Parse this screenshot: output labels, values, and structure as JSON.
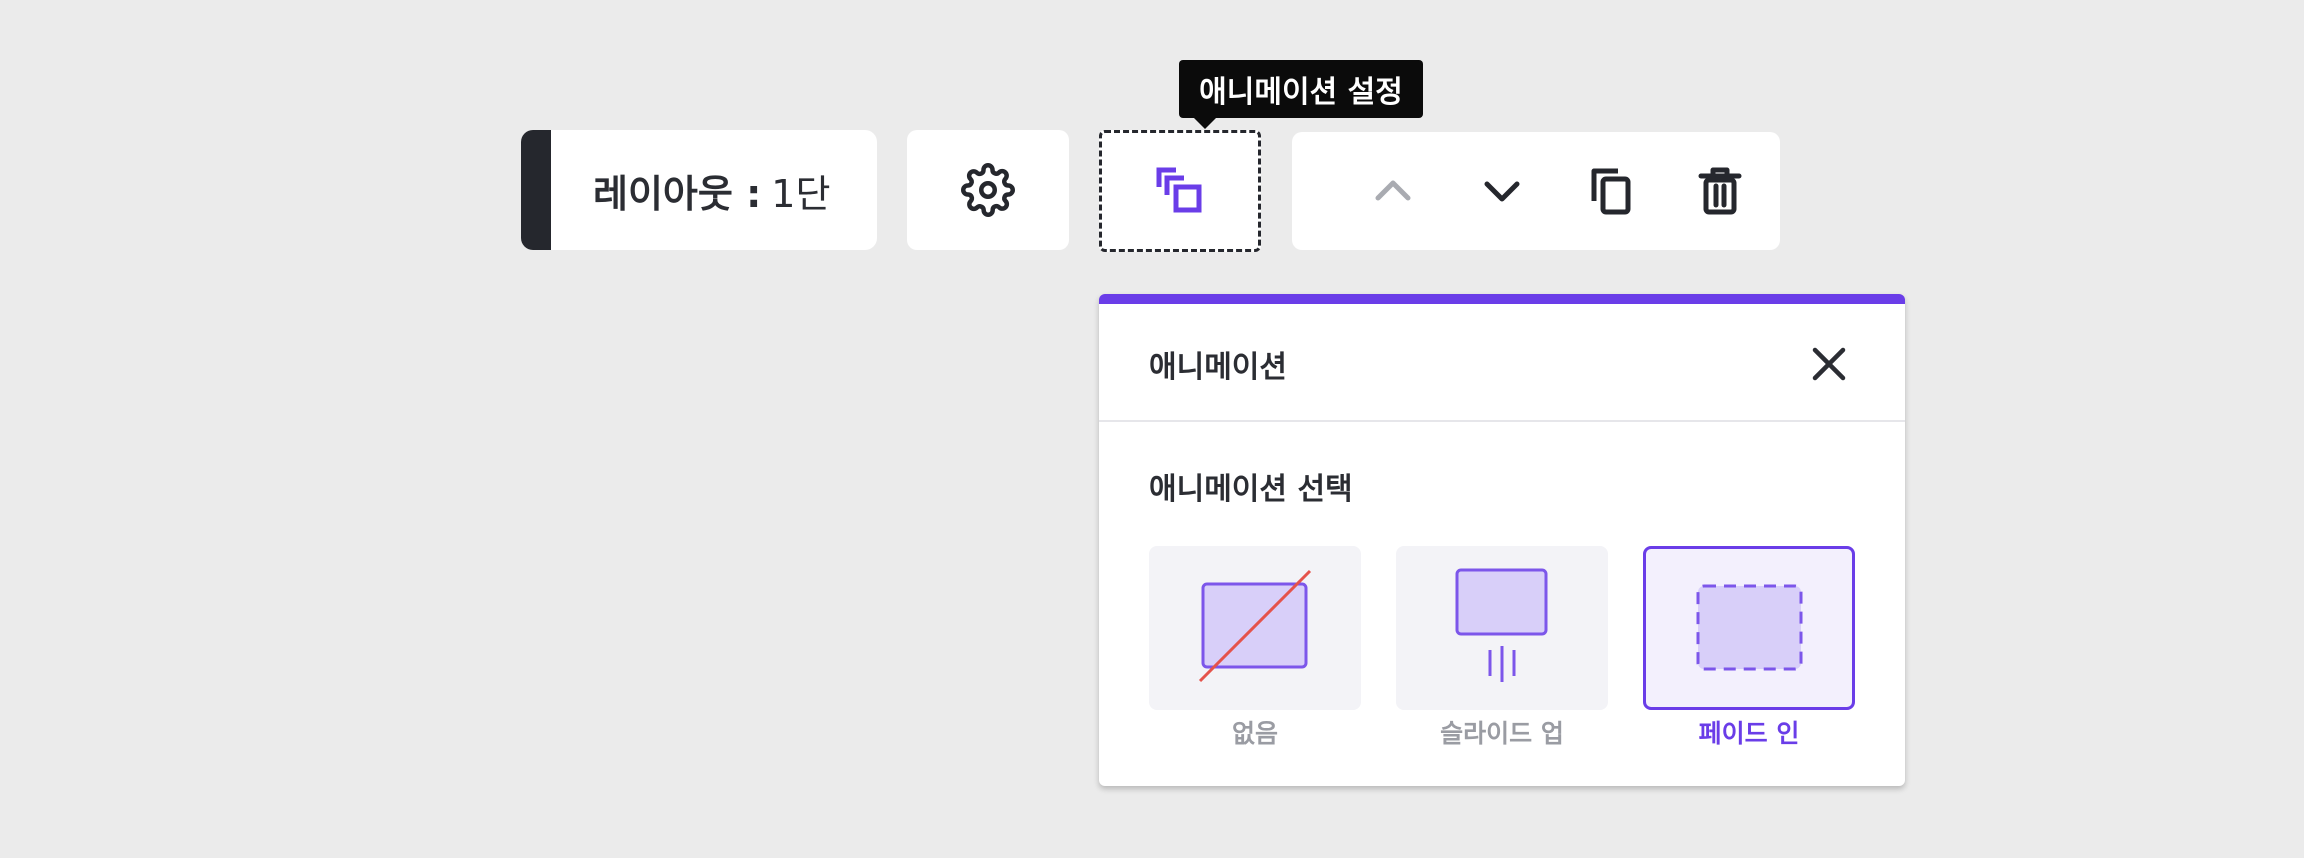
{
  "toolbar": {
    "layout_label": "레이아웃 :",
    "layout_value": "1단",
    "settings_icon": "gear-icon",
    "animation_icon": "animation-layers-icon",
    "actions": [
      {
        "name": "move-up",
        "icon": "chevron-up-icon",
        "enabled": false
      },
      {
        "name": "move-down",
        "icon": "chevron-down-icon",
        "enabled": true
      },
      {
        "name": "duplicate",
        "icon": "copy-icon",
        "enabled": true
      },
      {
        "name": "delete",
        "icon": "trash-icon",
        "enabled": true
      }
    ]
  },
  "tooltip": {
    "text": "애니메이션 설정"
  },
  "panel": {
    "title": "애니메이션",
    "close_icon": "close-icon",
    "section_title": "애니메이션 선택",
    "options": [
      {
        "label": "없음",
        "icon": "none-icon",
        "selected": false
      },
      {
        "label": "슬라이드 업",
        "icon": "slide-up-icon",
        "selected": false
      },
      {
        "label": "페이드 인",
        "icon": "fade-in-icon",
        "selected": true
      }
    ]
  },
  "colors": {
    "accent": "#6a3de8",
    "dark": "#25272d",
    "disabled": "#a9abb1",
    "background": "#ebebeb",
    "none_slash": "#e5534b"
  }
}
